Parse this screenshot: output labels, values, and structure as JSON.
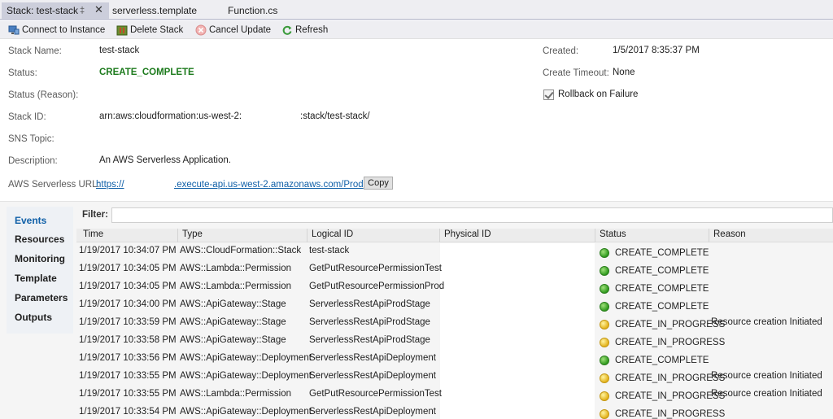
{
  "tabs": [
    {
      "label": "Stack: test-stack",
      "pin": "‡",
      "close": "✕"
    },
    {
      "label": "serverless.template"
    },
    {
      "label": "Function.cs"
    }
  ],
  "toolbar": {
    "connect_label": "Connect to Instance",
    "delete_label": "Delete Stack",
    "cancel_label": "Cancel Update",
    "refresh_label": "Refresh"
  },
  "stack": {
    "name_label": "Stack Name:",
    "name": "test-stack",
    "status_label": "Status:",
    "status": "CREATE_COMPLETE",
    "status_reason_label": "Status (Reason):",
    "status_reason": "",
    "id_label": "Stack ID:",
    "id_prefix": "arn:aws:cloudformation:us-west-2:",
    "id_suffix": ":stack/test-stack/",
    "sns_label": "SNS Topic:",
    "sns": "",
    "description_label": "Description:",
    "description": "An AWS Serverless Application.",
    "url_label": "AWS Serverless URL:",
    "url_prefix": "https://",
    "url_suffix": ".execute-api.us-west-2.amazonaws.com/Prod",
    "copy_label": "Copy",
    "created_label": "Created:",
    "created": "1/5/2017 8:35:37 PM",
    "timeout_label": "Create Timeout:",
    "timeout": "None",
    "rollback_label": "Rollback on Failure",
    "rollback_checked": true
  },
  "nav": [
    "Events",
    "Resources",
    "Monitoring",
    "Template",
    "Parameters",
    "Outputs"
  ],
  "filter_label": "Filter:",
  "filter_value": "",
  "columns": [
    "Time",
    "Type",
    "Logical ID",
    "Physical ID",
    "Status",
    "Reason"
  ],
  "events": [
    {
      "time": "1/19/2017 10:34:07 PM",
      "type": "AWS::CloudFormation::Stack",
      "logical": "test-stack",
      "status": "CREATE_COMPLETE",
      "reason": "",
      "color": "green"
    },
    {
      "time": "1/19/2017 10:34:05 PM",
      "type": "AWS::Lambda::Permission",
      "logical": "GetPutResourcePermissionTest",
      "status": "CREATE_COMPLETE",
      "reason": "",
      "color": "green"
    },
    {
      "time": "1/19/2017 10:34:05 PM",
      "type": "AWS::Lambda::Permission",
      "logical": "GetPutResourcePermissionProd",
      "status": "CREATE_COMPLETE",
      "reason": "",
      "color": "green"
    },
    {
      "time": "1/19/2017 10:34:00 PM",
      "type": "AWS::ApiGateway::Stage",
      "logical": "ServerlessRestApiProdStage",
      "status": "CREATE_COMPLETE",
      "reason": "",
      "color": "green"
    },
    {
      "time": "1/19/2017 10:33:59 PM",
      "type": "AWS::ApiGateway::Stage",
      "logical": "ServerlessRestApiProdStage",
      "status": "CREATE_IN_PROGRESS",
      "reason": "Resource creation Initiated",
      "color": "yellow"
    },
    {
      "time": "1/19/2017 10:33:58 PM",
      "type": "AWS::ApiGateway::Stage",
      "logical": "ServerlessRestApiProdStage",
      "status": "CREATE_IN_PROGRESS",
      "reason": "",
      "color": "yellow"
    },
    {
      "time": "1/19/2017 10:33:56 PM",
      "type": "AWS::ApiGateway::Deployment",
      "logical": "ServerlessRestApiDeployment",
      "status": "CREATE_COMPLETE",
      "reason": "",
      "color": "green"
    },
    {
      "time": "1/19/2017 10:33:55 PM",
      "type": "AWS::ApiGateway::Deployment",
      "logical": "ServerlessRestApiDeployment",
      "status": "CREATE_IN_PROGRESS",
      "reason": "Resource creation Initiated",
      "color": "yellow"
    },
    {
      "time": "1/19/2017 10:33:55 PM",
      "type": "AWS::Lambda::Permission",
      "logical": "GetPutResourcePermissionTest",
      "status": "CREATE_IN_PROGRESS",
      "reason": "Resource creation Initiated",
      "color": "yellow"
    },
    {
      "time": "1/19/2017 10:33:54 PM",
      "type": "AWS::ApiGateway::Deployment",
      "logical": "ServerlessRestApiDeployment",
      "status": "CREATE_IN_PROGRESS",
      "reason": "",
      "color": "yellow"
    }
  ]
}
